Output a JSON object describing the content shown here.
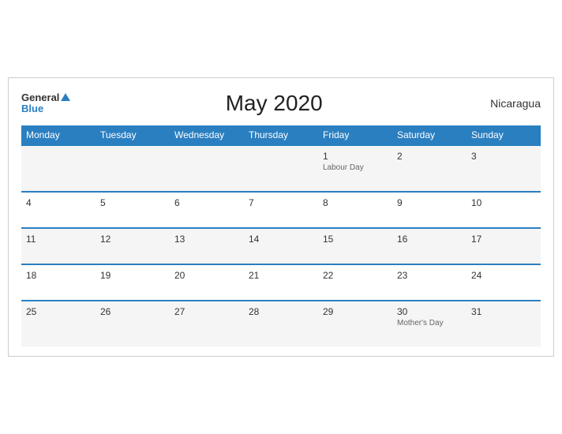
{
  "header": {
    "logo_general": "General",
    "logo_blue": "Blue",
    "title": "May 2020",
    "country": "Nicaragua"
  },
  "days_of_week": [
    "Monday",
    "Tuesday",
    "Wednesday",
    "Thursday",
    "Friday",
    "Saturday",
    "Sunday"
  ],
  "weeks": [
    [
      {
        "num": "",
        "event": ""
      },
      {
        "num": "",
        "event": ""
      },
      {
        "num": "",
        "event": ""
      },
      {
        "num": "",
        "event": ""
      },
      {
        "num": "1",
        "event": "Labour Day"
      },
      {
        "num": "2",
        "event": ""
      },
      {
        "num": "3",
        "event": ""
      }
    ],
    [
      {
        "num": "4",
        "event": ""
      },
      {
        "num": "5",
        "event": ""
      },
      {
        "num": "6",
        "event": ""
      },
      {
        "num": "7",
        "event": ""
      },
      {
        "num": "8",
        "event": ""
      },
      {
        "num": "9",
        "event": ""
      },
      {
        "num": "10",
        "event": ""
      }
    ],
    [
      {
        "num": "11",
        "event": ""
      },
      {
        "num": "12",
        "event": ""
      },
      {
        "num": "13",
        "event": ""
      },
      {
        "num": "14",
        "event": ""
      },
      {
        "num": "15",
        "event": ""
      },
      {
        "num": "16",
        "event": ""
      },
      {
        "num": "17",
        "event": ""
      }
    ],
    [
      {
        "num": "18",
        "event": ""
      },
      {
        "num": "19",
        "event": ""
      },
      {
        "num": "20",
        "event": ""
      },
      {
        "num": "21",
        "event": ""
      },
      {
        "num": "22",
        "event": ""
      },
      {
        "num": "23",
        "event": ""
      },
      {
        "num": "24",
        "event": ""
      }
    ],
    [
      {
        "num": "25",
        "event": ""
      },
      {
        "num": "26",
        "event": ""
      },
      {
        "num": "27",
        "event": ""
      },
      {
        "num": "28",
        "event": ""
      },
      {
        "num": "29",
        "event": ""
      },
      {
        "num": "30",
        "event": "Mother's Day"
      },
      {
        "num": "31",
        "event": ""
      }
    ]
  ]
}
